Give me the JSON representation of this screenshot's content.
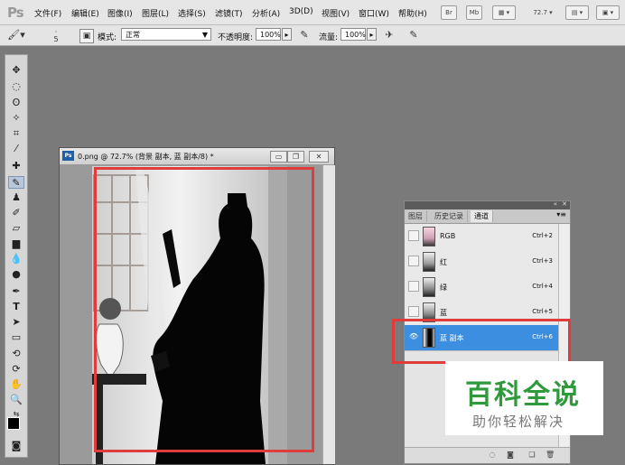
{
  "app": {
    "logo": "Ps"
  },
  "menu": [
    "文件(F)",
    "编辑(E)",
    "图像(I)",
    "图层(L)",
    "选择(S)",
    "滤镜(T)",
    "分析(A)",
    "3D(D)",
    "视图(V)",
    "窗口(W)",
    "帮助(H)"
  ],
  "menu_right": {
    "br": "Br",
    "mb": "Mb",
    "zoom": "72.7"
  },
  "options": {
    "brush_size": "5",
    "mode_label": "模式:",
    "mode_value": "正常",
    "opacity_label": "不透明度:",
    "opacity_value": "100%",
    "flow_label": "流量:",
    "flow_value": "100%"
  },
  "document": {
    "badge": "Ps",
    "title": "0.png @ 72.7% (背景 副本, 蓝 副本/8) *"
  },
  "panel": {
    "tabs": [
      "图层",
      "历史记录",
      "通道"
    ],
    "active_tab": 2,
    "channels": [
      {
        "name": "RGB",
        "shortcut": "Ctrl+2",
        "visible": false,
        "selected": false
      },
      {
        "name": "红",
        "shortcut": "Ctrl+3",
        "visible": false,
        "selected": false
      },
      {
        "name": "绿",
        "shortcut": "Ctrl+4",
        "visible": false,
        "selected": false
      },
      {
        "name": "蓝",
        "shortcut": "Ctrl+5",
        "visible": false,
        "selected": false
      },
      {
        "name": "蓝 副本",
        "shortcut": "Ctrl+6",
        "visible": true,
        "selected": true
      }
    ]
  },
  "watermark": {
    "main": "百科全说",
    "sub": "助你轻松解决"
  },
  "colors": {
    "highlight": "#e03c3c",
    "selection": "#3c8fe0",
    "watermark": "#2f9a3c"
  }
}
